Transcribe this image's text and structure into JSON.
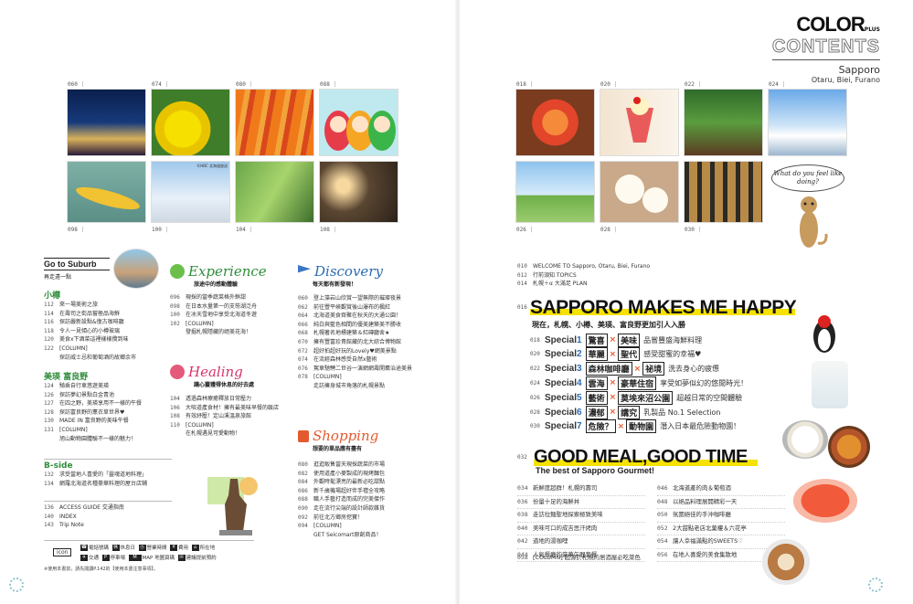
{
  "brand": {
    "logo_main": "COLOR",
    "logo_plus": "PLUS",
    "contents": "CONTENTS",
    "city": "Sapporo",
    "areas": "Otaru, Biei, Furano"
  },
  "left_photos": {
    "top_numbers": [
      "060",
      "074",
      "080",
      "088"
    ],
    "bottom_numbers": [
      "098",
      "100",
      "104",
      "108"
    ],
    "photo_caption": "©HBC 北海道放送"
  },
  "right_photos": {
    "top_numbers": [
      "018",
      "020",
      "022",
      "024"
    ],
    "bottom_numbers": [
      "026",
      "028",
      "030"
    ]
  },
  "mascot_bubble": "What do you feel like doing?",
  "suburb": {
    "title": "Go to Suburb",
    "subtitle": "再走遠一點",
    "otaru": {
      "heading": "小樽",
      "items": [
        {
          "n": "112",
          "t": "來一場美術之旅"
        },
        {
          "n": "114",
          "t": "在壽司之街品嘗極品海鮮"
        },
        {
          "n": "116",
          "t": "探訪嚴新設點&復古咖啡廳"
        },
        {
          "n": "118",
          "t": "令人一見傾心的小樽玻璃"
        },
        {
          "n": "120",
          "t": "美食ⅹ下酒菜這裡樣樣攬到味"
        },
        {
          "n": "122",
          "t": "[COLUMN]"
        },
        {
          "n": "",
          "t": "探訪威士忌和葡萄酒的故鄉余市"
        }
      ]
    },
    "biei": {
      "heading": "美瑛 富良野",
      "items": [
        {
          "n": "124",
          "t": "騎乘自行車悠遊美瑛"
        },
        {
          "n": "126",
          "t": "探訪夢幻景點白金青池"
        },
        {
          "n": "127",
          "t": "在四之野，美瑛享用不一樣的午餐"
        },
        {
          "n": "128",
          "t": "探訪富良野的薰衣草世界♥"
        },
        {
          "n": "130",
          "t": "MADE IN 富良野的美味午餐"
        },
        {
          "n": "131",
          "t": "[COLUMN]"
        },
        {
          "n": "",
          "t": "旭山動物園體驗不一樣的魅力！"
        }
      ]
    },
    "bside": {
      "heading": "B-side",
      "items": [
        {
          "n": "132",
          "t": "求受當地人喜愛的「靈魂道地料理」"
        },
        {
          "n": "134",
          "t": "網羅北海道名種豪華料理的屋台店鋪"
        }
      ]
    },
    "guide": [
      {
        "n": "136",
        "t": "ACCESS GUIDE 交通指南"
      },
      {
        "n": "140",
        "t": "INDEX"
      },
      {
        "n": "143",
        "t": "Trip Note"
      }
    ]
  },
  "legend": {
    "icon_label": "icon",
    "row1": [
      "電話號碼",
      "休息日",
      "營業時間",
      "費用",
      "所在地"
    ],
    "row2": [
      "交通",
      "停車場",
      "MAP 地圖頁碼",
      "建議提前預約"
    ],
    "note": "※使用本書前，請先閱讀P.142的【使用本書注意事項】。"
  },
  "experience": {
    "title": "Experience",
    "subtitle": "旅途中的感動體驗",
    "items": [
      {
        "n": "096",
        "t": "現採的當季蔬菜格外鮮甜"
      },
      {
        "n": "098",
        "t": "在日本水量第一的支笏湖泛舟"
      },
      {
        "n": "100",
        "t": "在冰天雪地中享受北海道冬遊"
      },
      {
        "n": "102",
        "t": "[COLUMN]"
      },
      {
        "n": "",
        "t": "發掘札幌隱藏的絕美花海！"
      }
    ]
  },
  "healing": {
    "title": "Healing",
    "subtitle": "讓心靈獲得休息的好去處",
    "items": [
      {
        "n": "104",
        "t": "透過森林療癒釋放日常壓力"
      },
      {
        "n": "106",
        "t": "大啖道產食材！擁有最美味早餐的飯店"
      },
      {
        "n": "108",
        "t": "有效紓壓！定山溪溫泉旅館"
      },
      {
        "n": "110",
        "t": "[COLUMN]"
      },
      {
        "n": "",
        "t": "在札幌遇見可愛動物！"
      }
    ]
  },
  "discovery": {
    "title": "Discovery",
    "subtitle": "每天都有新發現！",
    "items": [
      {
        "n": "060",
        "t": "登上藻岩山欣賞一望無際的璀璨夜景"
      },
      {
        "n": "062",
        "t": "前往豐平峽觀賞後山瀑布的楓紅"
      },
      {
        "n": "064",
        "t": "北海道美食齊聚在秋天的大通公園！"
      },
      {
        "n": "066",
        "t": "純白與藍色相間的優美建築美不勝收"
      },
      {
        "n": "068",
        "t": "札幌著名地標建築＆紅磚廳舍★"
      },
      {
        "n": "070",
        "t": "擁有豐富珍貴館藏的北大綜合博物館"
      },
      {
        "n": "072",
        "t": "超好拍超好玩的Lovely♥網美景點"
      },
      {
        "n": "074",
        "t": "在流經森林感受自然ⅹ藝術"
      },
      {
        "n": "076",
        "t": "駕車馳騁二世谷一演網網壽開蕎治途美景"
      },
      {
        "n": "078",
        "t": "[COLUMN]"
      },
      {
        "n": "",
        "t": "走訪擁身城市角落的札幌景點"
      }
    ]
  },
  "shopping": {
    "title": "Shopping",
    "subtitle": "想要的單品應有盡有",
    "items": [
      {
        "n": "080",
        "t": "逛逛販售當天現採蔬菜的市場"
      },
      {
        "n": "082",
        "t": "使用道產小麥製成的現烤麵包"
      },
      {
        "n": "084",
        "t": "外觀時髦漂亮的最新必吃甜點"
      },
      {
        "n": "086",
        "t": "新千歲機場超好伴手禮全攻略"
      },
      {
        "n": "088",
        "t": "職人手藝打造而成的完美傑作"
      },
      {
        "n": "090",
        "t": "走在流行尖端的設計師款雜貨"
      },
      {
        "n": "092",
        "t": "前往北方鄉房挖寶！"
      },
      {
        "n": "094",
        "t": "[COLUMN]"
      },
      {
        "n": "",
        "t": "GET Seicomart原創商品！"
      }
    ]
  },
  "welcome": [
    {
      "n": "010",
      "t": "WELCOME TO Sapporo, Otaru, Biei, Furano"
    },
    {
      "n": "012",
      "t": "行前須知 TOPICS"
    },
    {
      "n": "014",
      "t": "札幌＋α 大滿足 PLAN"
    }
  ],
  "happy": {
    "page": "016",
    "title": "SAPPORO MAKES ME HAPPY",
    "subtitle": "現在，札幌、小樽、美瑛、富良野更加引人入勝"
  },
  "specials": [
    {
      "n": "018",
      "label": "Special",
      "num": "1",
      "k1": "驚喜",
      "k2": "美味",
      "rest": "品嘗豐盛海鮮料理"
    },
    {
      "n": "020",
      "label": "Special",
      "num": "2",
      "k1": "華麗",
      "k2": "聖代",
      "rest": "感受甜蜜的幸福♥"
    },
    {
      "n": "022",
      "label": "Special",
      "num": "3",
      "k1": "森林咖啡廳",
      "k2": "祕境",
      "rest": "洗去身心的疲憊"
    },
    {
      "n": "024",
      "label": "Special",
      "num": "4",
      "k1": "雲海",
      "k2": "豪華住宿",
      "rest": "享受如夢似幻的悠閒時光！"
    },
    {
      "n": "026",
      "label": "Special",
      "num": "5",
      "k1": "藝術",
      "k2": "莫埃來沼公園",
      "rest": "超越日常的空間體驗"
    },
    {
      "n": "028",
      "label": "Special",
      "num": "6",
      "k1": "濃郁",
      "k2": "講究",
      "rest": "乳製品 No.1 Selection"
    },
    {
      "n": "030",
      "label": "Special",
      "num": "7",
      "k1": "危險？",
      "k2": "動物園",
      "rest": "潛入日本最危險動物園！"
    }
  ],
  "good_meal": {
    "page": "032",
    "title": "GOOD MEAL,GOOD TIME",
    "subtitle": "The best of Sapporo Gourmet!",
    "left": [
      {
        "n": "034",
        "t": "新鮮度超群！札幌的壽司"
      },
      {
        "n": "036",
        "t": "份量十足的海鮮丼"
      },
      {
        "n": "038",
        "t": "走訪拉麵聖地探索極致美味"
      },
      {
        "n": "040",
        "t": "美味可口的成吉思汗烤肉"
      },
      {
        "n": "042",
        "t": "道地的湯咖哩"
      },
      {
        "n": "044",
        "t": "人氣餐廳的豪華午間套餐"
      }
    ],
    "right": [
      {
        "n": "046",
        "t": "北海道產的肉＆葡萄酒"
      },
      {
        "n": "048",
        "t": "以絕品料理展開精彩一天"
      },
      {
        "n": "050",
        "t": "氛圍絕佳的手沖咖啡廳"
      },
      {
        "n": "052",
        "t": "2大甜點老店北菓樓＆六花亭"
      },
      {
        "n": "054",
        "t": "讓人幸福滿點的SWEETS♡"
      },
      {
        "n": "056",
        "t": "在地人喜愛的美食集散地"
      }
    ],
    "column": {
      "n": "058",
      "t": "[COLUMN] 超源於札幌的居酒屋必吃菜色"
    }
  }
}
